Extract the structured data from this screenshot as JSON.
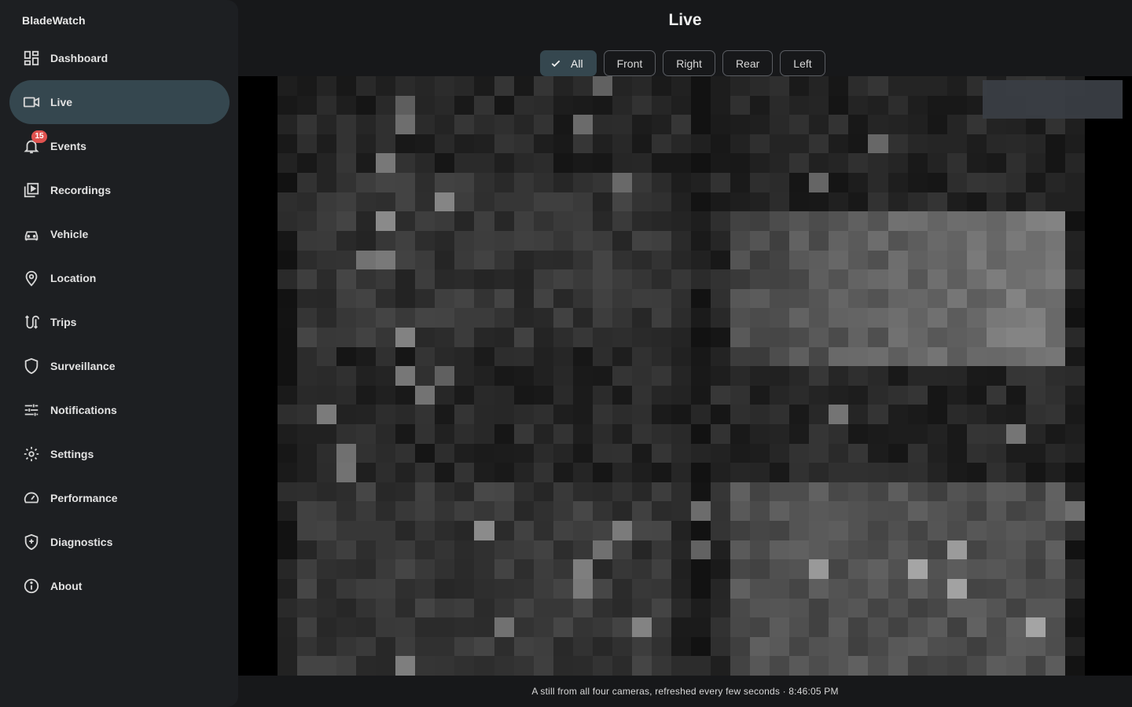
{
  "app": {
    "title": "BladeWatch"
  },
  "sidebar": {
    "items": [
      {
        "label": "Dashboard",
        "icon": "dashboard-icon",
        "active": false
      },
      {
        "label": "Live",
        "icon": "videocam-icon",
        "active": true
      },
      {
        "label": "Events",
        "icon": "bell-icon",
        "active": false,
        "badge": "15"
      },
      {
        "label": "Recordings",
        "icon": "video-library-icon",
        "active": false
      },
      {
        "label": "Vehicle",
        "icon": "car-icon",
        "active": false
      },
      {
        "label": "Location",
        "icon": "location-pin-icon",
        "active": false
      },
      {
        "label": "Trips",
        "icon": "route-icon",
        "active": false
      },
      {
        "label": "Surveillance",
        "icon": "shield-icon",
        "active": false
      },
      {
        "label": "Notifications",
        "icon": "tune-sliders-icon",
        "active": false
      },
      {
        "label": "Settings",
        "icon": "gear-icon",
        "active": false
      },
      {
        "label": "Performance",
        "icon": "speedometer-icon",
        "active": false
      },
      {
        "label": "Diagnostics",
        "icon": "shield-plus-icon",
        "active": false
      },
      {
        "label": "About",
        "icon": "info-icon",
        "active": false
      }
    ]
  },
  "main": {
    "title": "Live",
    "filters": [
      {
        "label": "All",
        "selected": true
      },
      {
        "label": "Front",
        "selected": false
      },
      {
        "label": "Right",
        "selected": false
      },
      {
        "label": "Rear",
        "selected": false
      },
      {
        "label": "Left",
        "selected": false
      }
    ],
    "caption": "A still from all four cameras, refreshed every few seconds · 8:46:05 PM"
  },
  "colors": {
    "background": "#17181a",
    "sidebar": "#1d1f22",
    "accent": "#35474f",
    "badge": "#e0524f"
  }
}
